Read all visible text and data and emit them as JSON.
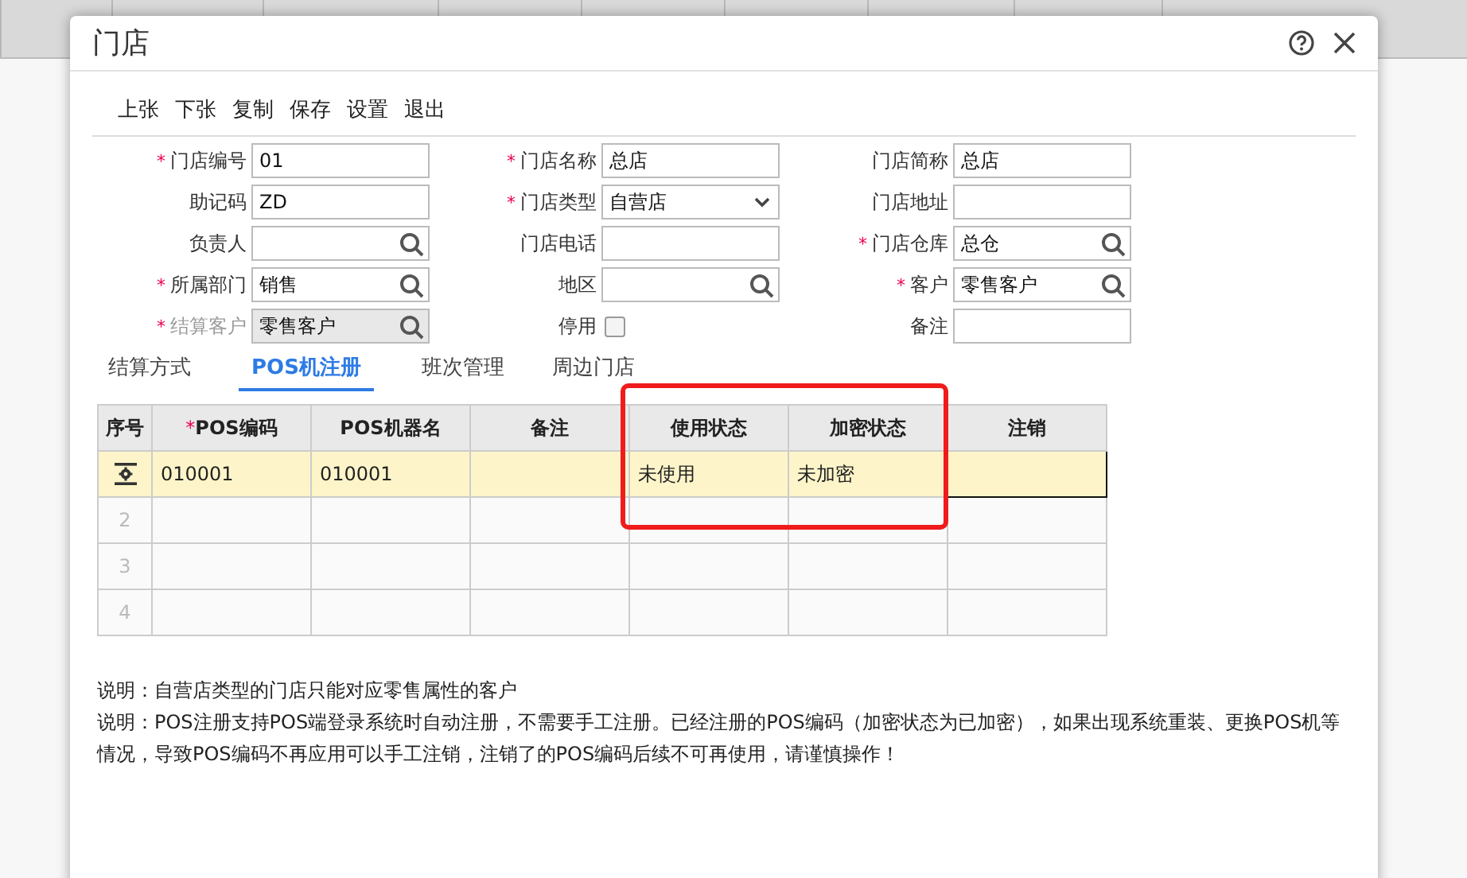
{
  "dialog": {
    "title": "门店"
  },
  "toolbar": [
    "上张",
    "下张",
    "复制",
    "保存",
    "设置",
    "退出"
  ],
  "fields": [
    {
      "label": "门店编号",
      "required_mark": "*",
      "kind": "text",
      "value": "01",
      "disabled": false
    },
    {
      "label": "门店名称",
      "required_mark": "*",
      "kind": "text",
      "value": "总店",
      "disabled": false
    },
    {
      "label": "门店简称",
      "kind": "text",
      "value": "总店",
      "disabled": false
    },
    {
      "label": "助记码",
      "kind": "text",
      "value": "ZD",
      "disabled": false
    },
    {
      "label": "门店类型",
      "required_mark": "*",
      "kind": "select",
      "value": "自营店",
      "disabled": false
    },
    {
      "label": "门店地址",
      "kind": "text",
      "disabled": false
    },
    {
      "label": "负责人",
      "kind": "lookup",
      "disabled": false
    },
    {
      "label": "门店电话",
      "kind": "text",
      "disabled": false
    },
    {
      "label": "门店仓库",
      "required_mark": "*",
      "kind": "lookup",
      "value": "总仓",
      "disabled": false
    },
    {
      "label": "所属部门",
      "required_mark": "*",
      "kind": "lookup",
      "value": "销售",
      "disabled": false
    },
    {
      "label": "地区",
      "kind": "lookup",
      "disabled": false
    },
    {
      "label": "客户",
      "required_mark": "*",
      "kind": "lookup",
      "value": "零售客户",
      "disabled": false
    },
    {
      "label": "结算客户",
      "required_mark": "*",
      "kind": "lookup",
      "value": "零售客户",
      "disabled": true
    },
    {
      "label": "停用",
      "kind": "checkbox",
      "checked": false,
      "disabled": false
    },
    {
      "label": "备注",
      "kind": "text",
      "disabled": false
    }
  ],
  "tabs": [
    {
      "label": "结算方式",
      "selected": false
    },
    {
      "label": "POS机注册",
      "selected": true
    },
    {
      "label": "班次管理",
      "selected": false
    },
    {
      "label": "周边门店",
      "selected": false
    }
  ],
  "table": {
    "columns": [
      {
        "label": "序号"
      },
      {
        "label": "POS编码",
        "required_mark": "*"
      },
      {
        "label": "POS机器名"
      },
      {
        "label": "备注"
      },
      {
        "label": "使用状态"
      },
      {
        "label": "加密状态"
      },
      {
        "label": "注销"
      }
    ],
    "rows": [
      {
        "kind": "current",
        "cells": [
          {
            "text": "010001",
            "selected": false
          },
          {
            "text": "010001",
            "selected": false
          },
          {
            "selected": false
          },
          {
            "text": "未使用",
            "selected": false
          },
          {
            "text": "未加密",
            "selected": false
          },
          {
            "selected": true
          }
        ]
      },
      {
        "kind": "empty",
        "seq": "2"
      },
      {
        "kind": "empty",
        "seq": "3"
      },
      {
        "kind": "empty",
        "seq": "4"
      }
    ]
  },
  "notes": [
    "说明：自营店类型的门店只能对应零售属性的客户",
    "说明：POS注册支持POS端登录系统时自动注册，不需要手工注册。已经注册的POS编码（加密状态为已加密），如果出现系统重装、更换POS机等情况，导致POS编码不再应用可以手工注销，注销了的POS编码后续不可再使用，请谨慎操作！"
  ]
}
